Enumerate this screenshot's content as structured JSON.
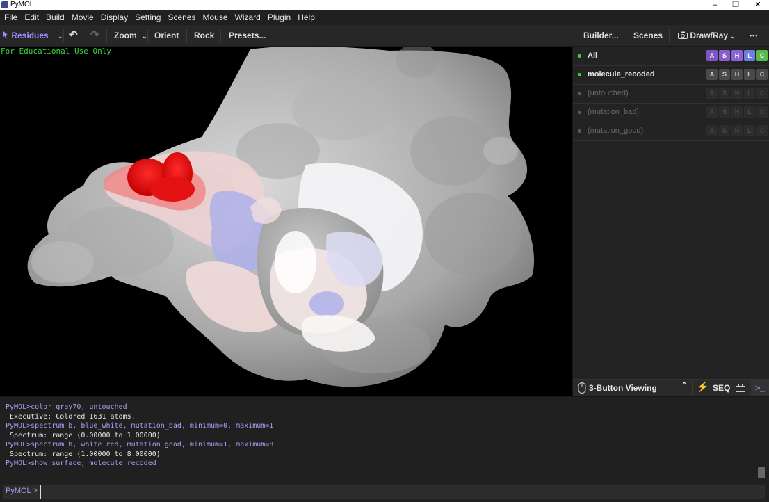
{
  "window": {
    "title": "PyMOL",
    "minimize": "–",
    "maximize": "❐",
    "close": "✕"
  },
  "menu": [
    "File",
    "Edit",
    "Build",
    "Movie",
    "Display",
    "Setting",
    "Scenes",
    "Mouse",
    "Wizard",
    "Plugin",
    "Help"
  ],
  "toolbar": {
    "selection_mode": "Residues",
    "undo": "↶",
    "redo": "↷",
    "zoom": "Zoom",
    "orient": "Orient",
    "rock": "Rock",
    "presets": "Presets...",
    "builder": "Builder...",
    "scenes": "Scenes",
    "draw_ray": "Draw/Ray",
    "more": "•••"
  },
  "viewport": {
    "watermark": "For Educational Use Only"
  },
  "objects": [
    {
      "name": "All",
      "enabled": true,
      "style": "all"
    },
    {
      "name": "molecule_recoded",
      "enabled": true,
      "style": "object"
    },
    {
      "name": "(untouched)",
      "enabled": false,
      "style": "selection"
    },
    {
      "name": "(mutation_bad)",
      "enabled": false,
      "style": "selection"
    },
    {
      "name": "(mutation_good)",
      "enabled": false,
      "style": "selection"
    }
  ],
  "action_buttons": [
    "A",
    "S",
    "H",
    "L",
    "C"
  ],
  "action_colors": {
    "A": "#7b56c4",
    "S": "#8a5cc9",
    "H": "#8c63d6",
    "L": "#6d7de0",
    "C": "#5bb84a"
  },
  "modebar": {
    "label": "3-Button Viewing",
    "seq": "SEQ"
  },
  "console": {
    "lines": [
      {
        "kind": "cmd",
        "text": "PyMOL>color gray70, untouched"
      },
      {
        "kind": "out",
        "text": " Executive: Colored 1631 atoms."
      },
      {
        "kind": "cmd",
        "text": "PyMOL>spectrum b, blue_white, mutation_bad, minimum=0, maximum=1"
      },
      {
        "kind": "out",
        "text": " Spectrum: range (0.00000 to 1.00000)"
      },
      {
        "kind": "cmd",
        "text": "PyMOL>spectrum b, white_red, mutation_good, minimum=1, maximum=8"
      },
      {
        "kind": "out",
        "text": " Spectrum: range (1.00000 to 8.00000)"
      },
      {
        "kind": "cmd",
        "text": "PyMOL>show surface, molecule_recoded"
      }
    ],
    "prompt": "PyMOL >",
    "input_value": ""
  }
}
